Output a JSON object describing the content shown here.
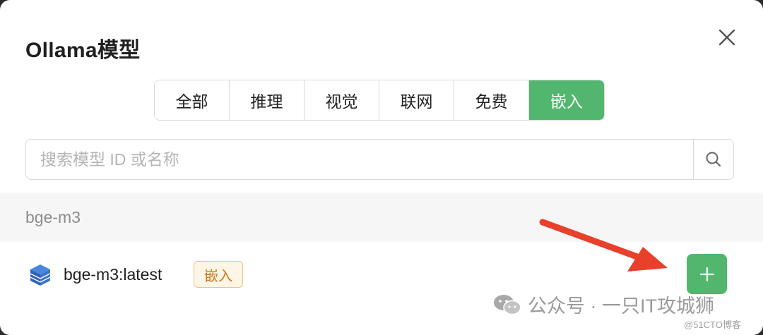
{
  "dialog": {
    "title": "Ollama模型",
    "close_icon": "close-icon"
  },
  "tabs": [
    {
      "label": "全部",
      "active": false
    },
    {
      "label": "推理",
      "active": false
    },
    {
      "label": "视觉",
      "active": false
    },
    {
      "label": "联网",
      "active": false
    },
    {
      "label": "免费",
      "active": false
    },
    {
      "label": "嵌入",
      "active": true
    }
  ],
  "search": {
    "placeholder": "搜索模型 ID 或名称",
    "value": "",
    "icon": "search-icon"
  },
  "groups": [
    {
      "name": "bge-m3",
      "models": [
        {
          "name": "bge-m3:latest",
          "tag": "嵌入",
          "icon": "model-cube-icon",
          "action_icon": "plus-icon"
        }
      ]
    }
  ],
  "watermark": {
    "text": "公众号 · 一只IT攻城狮",
    "icon": "wechat-icon",
    "blog": "@51CTO博客"
  },
  "colors": {
    "accent": "#52b66e",
    "badge_border": "#f0c27d",
    "badge_text": "#c77a1a",
    "annotation_arrow": "#e8402a"
  }
}
